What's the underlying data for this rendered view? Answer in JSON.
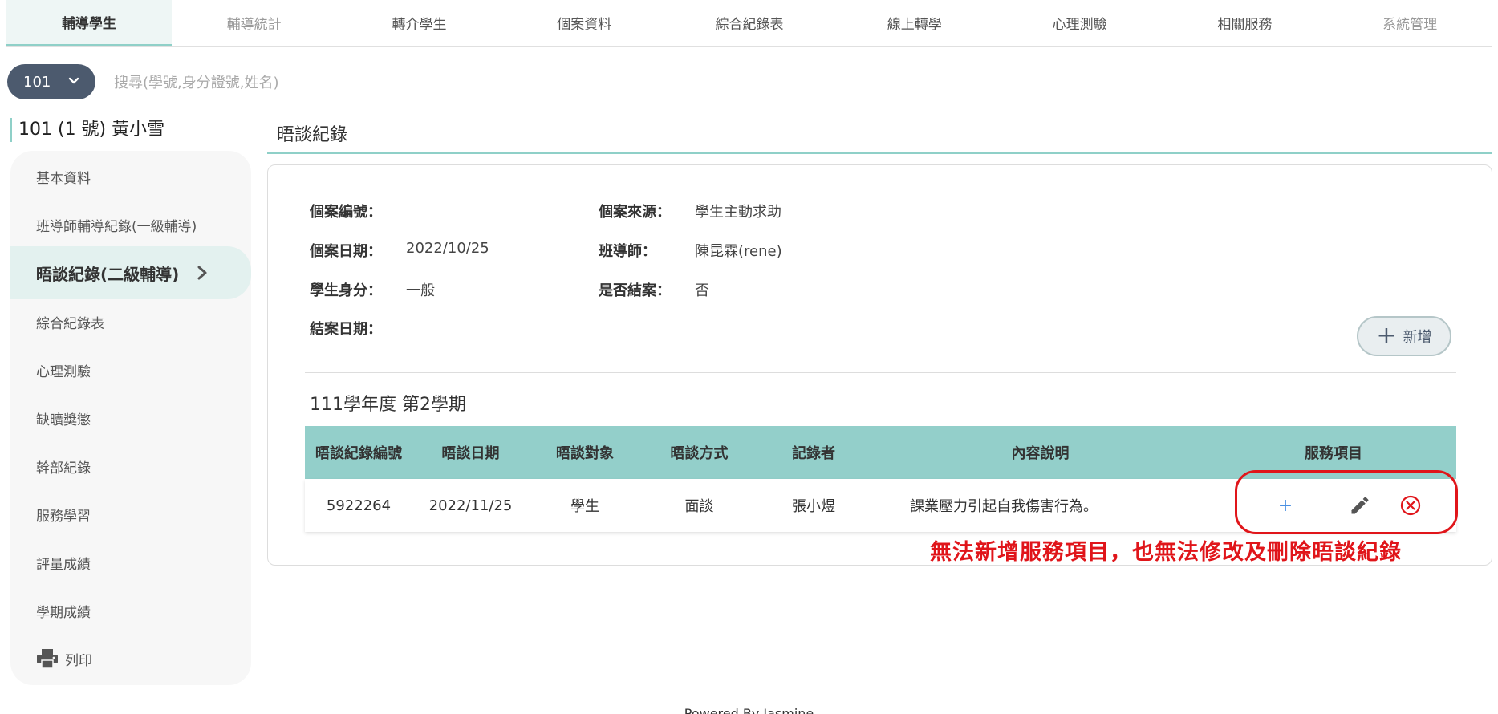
{
  "nav": {
    "tabs": [
      {
        "label": "輔導學生"
      },
      {
        "label": "輔導統計"
      },
      {
        "label": "轉介學生"
      },
      {
        "label": "個案資料"
      },
      {
        "label": "綜合紀錄表"
      },
      {
        "label": "線上轉學"
      },
      {
        "label": "心理測驗"
      },
      {
        "label": "相關服務"
      },
      {
        "label": "系統管理"
      }
    ]
  },
  "search": {
    "class_value": "101",
    "placeholder": "搜尋(學號,身分證號,姓名)"
  },
  "student": {
    "name": "101 (1 號) 黃小雪"
  },
  "sidebar": {
    "items": [
      {
        "label": "基本資料"
      },
      {
        "label": "班導師輔導紀錄(一級輔導)"
      },
      {
        "label": "晤談紀錄(二級輔導)"
      },
      {
        "label": "綜合紀錄表"
      },
      {
        "label": "心理測驗"
      },
      {
        "label": "缺曠獎懲"
      },
      {
        "label": "幹部紀錄"
      },
      {
        "label": "服務學習"
      },
      {
        "label": "評量成績"
      },
      {
        "label": "學期成績"
      },
      {
        "label": "列印"
      }
    ]
  },
  "main": {
    "title": "晤談紀錄",
    "fields": {
      "case_no_label": "個案編號：",
      "case_no_value": "",
      "source_label": "個案來源：",
      "source_value": "學生主動求助",
      "date_label": "個案日期：",
      "date_value": "2022/10/25",
      "teacher_label": "班導師：",
      "teacher_value": "陳昆霖(rene)",
      "identity_label": "學生身分：",
      "identity_value": "一般",
      "closed_label": "是否結案：",
      "closed_value": "否",
      "close_date_label": "結案日期：",
      "close_date_value": ""
    },
    "add_label": "新增",
    "semester": "111學年度 第2學期",
    "table": {
      "headers": [
        "晤談紀錄編號",
        "晤談日期",
        "晤談對象",
        "晤談方式",
        "記錄者",
        "內容說明",
        "服務項目"
      ],
      "rows": [
        {
          "id": "5922264",
          "date": "2022/11/25",
          "target": "學生",
          "method": "面談",
          "recorder": "張小煜",
          "content": "課業壓力引起自我傷害行為。",
          "service_add": "+"
        }
      ]
    },
    "annotation": "無法新增服務項目，也無法修改及刪除晤談紀錄"
  },
  "footer": {
    "text": "Powered By Jasmine"
  },
  "colors": {
    "accent": "#8fd0c8",
    "table_header": "#93cfca",
    "class_select": "#4c5a6e",
    "alert": "#e0151a",
    "add_icon": "#4a90e2"
  }
}
